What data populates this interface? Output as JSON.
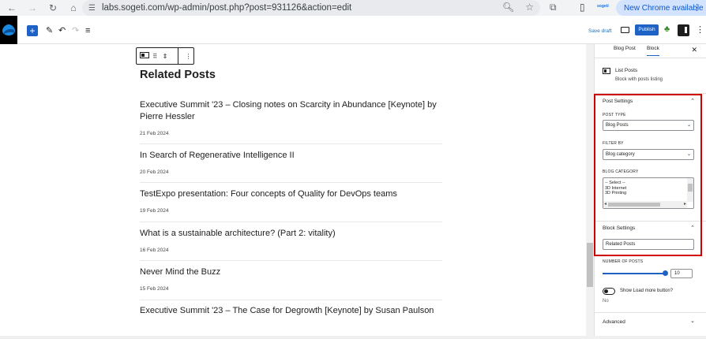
{
  "browser": {
    "url": "labs.sogeti.com/wp-admin/post.php?post=931126&action=edit",
    "update_label": "New Chrome available",
    "profile_label": "sogeti"
  },
  "toolbar": {
    "save_draft": "Save draft",
    "publish": "Publish"
  },
  "block_toolbar": {},
  "editor": {
    "heading": "Related Posts",
    "posts": [
      {
        "title": "Executive Summit '23 – Closing notes on Scarcity in Abundance [Keynote] by Pierre Hessler",
        "date": "21 Feb 2024"
      },
      {
        "title": "In Search of Regenerative Intelligence II",
        "date": "20 Feb 2024"
      },
      {
        "title": "TestExpo presentation: Four concepts of Quality for DevOps teams",
        "date": "19 Feb 2024"
      },
      {
        "title": "What is a sustainable architecture? (Part 2: vitality)",
        "date": "16 Feb 2024"
      },
      {
        "title": "Never Mind the Buzz",
        "date": "15 Feb 2024"
      },
      {
        "title": "Executive Summit '23 – The Case for Degrowth  [Keynote] by Susan Paulson",
        "date": ""
      }
    ]
  },
  "sidebar": {
    "tabs": [
      "Blog Post",
      "Block"
    ],
    "active_tab": "Block",
    "block_name": "List Posts",
    "block_desc": "Block with posts listing",
    "post_settings": {
      "title": "Post Settings",
      "post_type_label": "POST TYPE",
      "post_type_value": "Blog Posts",
      "filter_by_label": "FILTER BY",
      "filter_by_value": "Blog category",
      "blog_category_label": "BLOG CATEGORY",
      "blog_category_options": [
        "-- Select --",
        "3D Internet",
        "3D Printing"
      ]
    },
    "block_settings": {
      "title": "Block Settings",
      "heading_value": "Related Posts",
      "number_label": "NUMBER OF POSTS",
      "number_value": "10",
      "load_more_label": "Show Load more button?",
      "load_more_state": "No"
    },
    "advanced": "Advanced"
  },
  "colors": {
    "accent": "#1d62c4",
    "highlight": "#d00000"
  }
}
